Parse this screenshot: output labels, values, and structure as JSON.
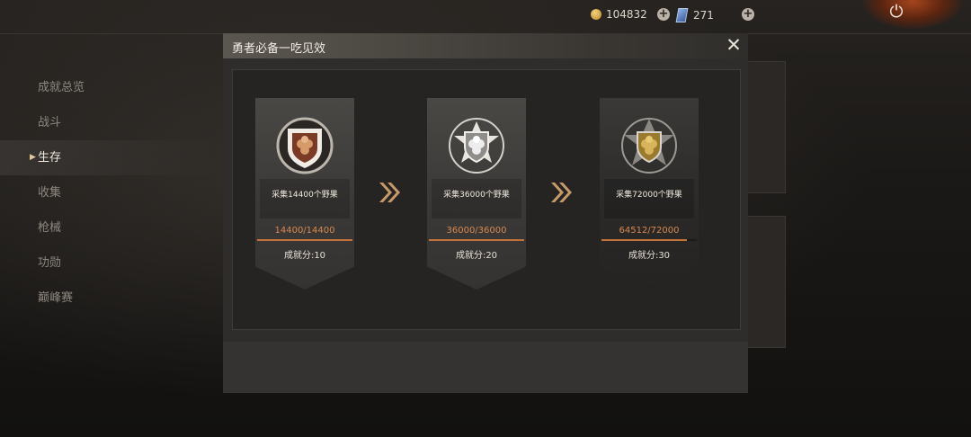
{
  "topbar": {
    "coins": "104832",
    "gems": "271",
    "coin_icon": "coin-icon",
    "gem_icon": "gem-icon",
    "power_icon": "power-icon",
    "power_glyph": "⏻",
    "plus_glyph": "+"
  },
  "sidebar": {
    "items": [
      {
        "label": "成就总览",
        "active": false
      },
      {
        "label": "战斗",
        "active": false
      },
      {
        "label": "生存",
        "active": true
      },
      {
        "label": "收集",
        "active": false
      },
      {
        "label": "枪械",
        "active": false
      },
      {
        "label": "功勋",
        "active": false
      },
      {
        "label": "巅峰赛",
        "active": false
      }
    ]
  },
  "modal": {
    "title": "勇者必备一吃见效",
    "close_glyph": "✕",
    "arrow_glyph": "»",
    "tiers": [
      {
        "rank": "bronze",
        "desc": "采集14400个野果",
        "progress": "14400/14400",
        "fill": 1.0,
        "points": "成就分:10",
        "accent": "#b0603a"
      },
      {
        "rank": "silver",
        "desc": "采集36000个野果",
        "progress": "36000/36000",
        "fill": 1.0,
        "points": "成就分:20",
        "accent": "#c9c9c9"
      },
      {
        "rank": "gold",
        "desc": "采集72000个野果",
        "progress": "64512/72000",
        "fill": 0.896,
        "points": "成就分:30",
        "accent": "#b9963e"
      }
    ]
  },
  "colors": {
    "accent_orange": "#d7894f",
    "panel": "#2f2d2b"
  }
}
